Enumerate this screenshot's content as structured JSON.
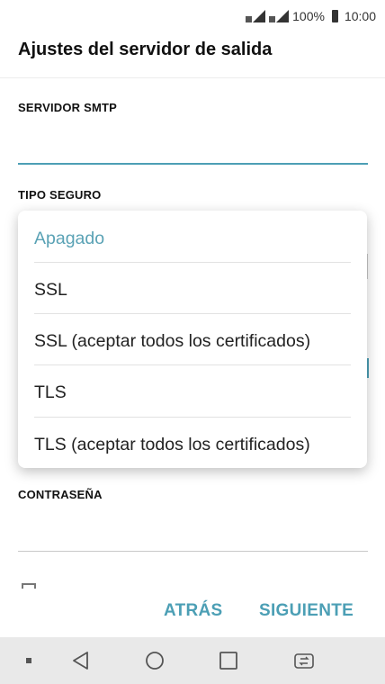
{
  "status": {
    "battery": "100%",
    "time": "10:00"
  },
  "header": {
    "title": "Ajustes del servidor de salida"
  },
  "form": {
    "smtp_label": "SERVIDOR SMTP",
    "smtp_value": "",
    "secure_label": "TIPO SEGURO",
    "password_label": "CONTRASEÑA",
    "password_value": ""
  },
  "dropdown": {
    "selected": "Apagado",
    "options": [
      "Apagado",
      "SSL",
      "SSL (aceptar todos los certificados)",
      "TLS",
      "TLS (aceptar todos los certificados)"
    ]
  },
  "buttons": {
    "back": "ATRÁS",
    "next": "SIGUIENTE"
  },
  "colors": {
    "accent": "#4c9fb5",
    "nav_bg": "#e9e9e9"
  },
  "nav_icons": [
    "dot-icon",
    "back-triangle-icon",
    "home-circle-icon",
    "recents-square-icon",
    "dual-window-icon"
  ]
}
